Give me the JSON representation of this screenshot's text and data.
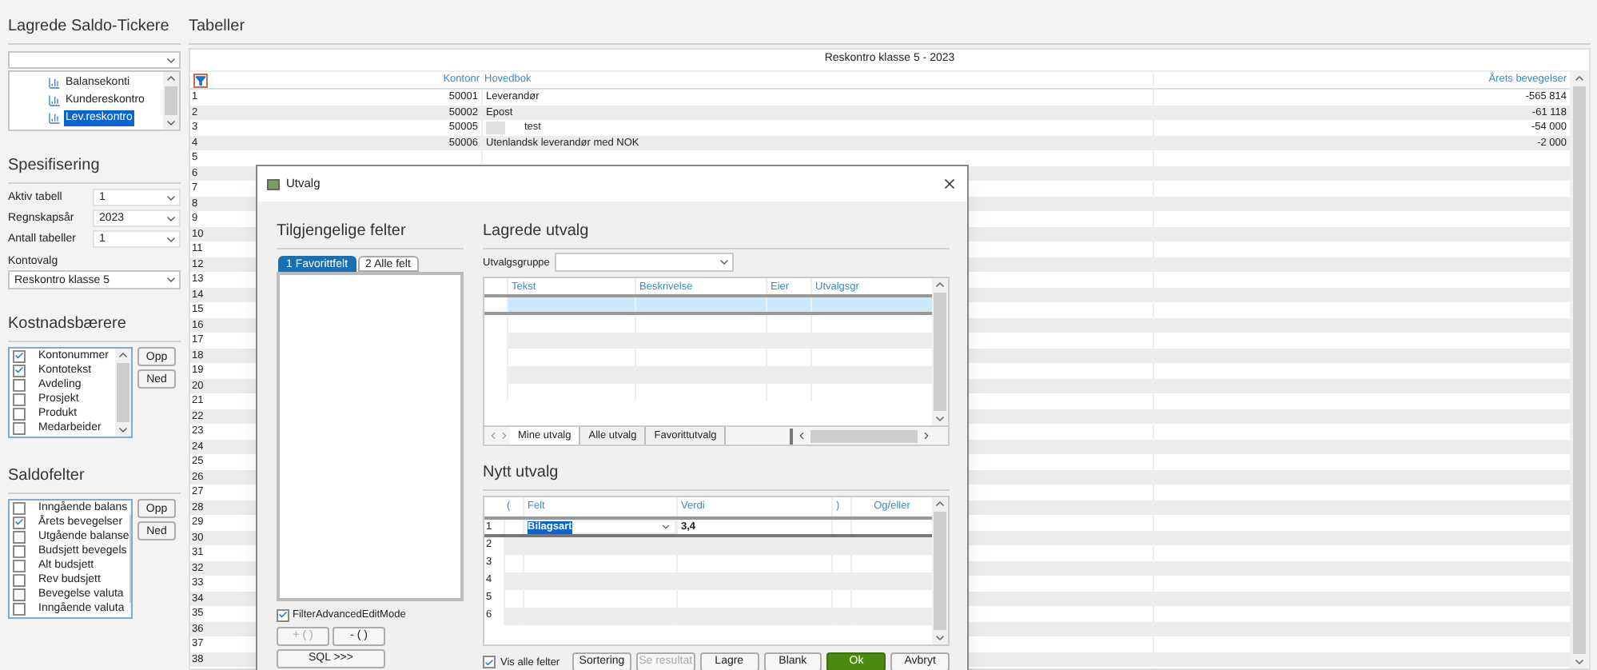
{
  "left_panel": {
    "saldo_tickers": {
      "title": "Lagrede Saldo-Tickere",
      "items": [
        {
          "label": "Balansekonti",
          "selected": false
        },
        {
          "label": "Kundereskontro",
          "selected": false
        },
        {
          "label": "Lev.reskontro",
          "selected": true
        }
      ]
    },
    "spesifisering": {
      "title": "Spesifisering",
      "fields": [
        {
          "label": "Aktiv tabell",
          "value": "1"
        },
        {
          "label": "Regnskapsår",
          "value": "2023"
        },
        {
          "label": "Antall tabeller",
          "value": "1"
        }
      ],
      "kontovalg": {
        "label": "Kontovalg",
        "value": "Reskontro klasse 5"
      }
    },
    "kostnadsbaerere": {
      "title": "Kostnadsbærere",
      "items": [
        {
          "label": "Kontonummer",
          "checked": true
        },
        {
          "label": "Kontotekst",
          "checked": true
        },
        {
          "label": "Avdeling",
          "checked": false
        },
        {
          "label": "Prosjekt",
          "checked": false
        },
        {
          "label": "Produkt",
          "checked": false
        },
        {
          "label": "Medarbeider",
          "checked": false
        }
      ],
      "buttons": [
        "Opp",
        "Ned"
      ]
    },
    "saldofelter": {
      "title": "Saldofelter",
      "items": [
        {
          "label": "Inngående balans",
          "checked": false
        },
        {
          "label": "Årets bevegelser",
          "checked": true
        },
        {
          "label": "Utgående balanse",
          "checked": false
        },
        {
          "label": "Budsjett bevegels",
          "checked": false
        },
        {
          "label": "Alt budsjett",
          "checked": false
        },
        {
          "label": "Rev budsjett",
          "checked": false
        },
        {
          "label": "Bevegelse valuta",
          "checked": false
        },
        {
          "label": "Inngående valuta",
          "checked": false
        }
      ],
      "buttons": [
        "Opp",
        "Ned"
      ]
    }
  },
  "tables": {
    "title": "Tabeller",
    "table_title": "Reskontro klasse 5 - 2023",
    "columns": [
      "Kontonr",
      "Hovedbok",
      "Årets bevegelser"
    ],
    "rows": [
      {
        "number": "1",
        "kontonr": "50001",
        "hovedbok": "Leverandør",
        "amount": "-565 814",
        "redacted": false
      },
      {
        "number": "2",
        "kontonr": "50002",
        "hovedbok": "Epost",
        "amount": "-61 118",
        "redacted": false
      },
      {
        "number": "3",
        "kontonr": "50005",
        "hovedbok": "test",
        "amount": "-54 000",
        "redacted": true
      },
      {
        "number": "4",
        "kontonr": "50006",
        "hovedbok": "Utenlandsk leverandør med NOK",
        "amount": "-2 000",
        "redacted": false
      }
    ],
    "empty_rows": [
      "5",
      "6",
      "7",
      "8",
      "9",
      "10",
      "11",
      "12",
      "13",
      "14",
      "15",
      "16",
      "17",
      "18",
      "19",
      "20",
      "21",
      "22",
      "23",
      "24",
      "25",
      "26",
      "27",
      "28",
      "29",
      "30",
      "31",
      "32",
      "33",
      "34",
      "35",
      "36",
      "37",
      "38"
    ]
  },
  "dialog": {
    "title": "Utvalg",
    "available_fields": {
      "title": "Tilgjengelige felter",
      "tabs": [
        {
          "label": "1 Favorittfelt",
          "selected": true
        },
        {
          "label": "2 Alle felt",
          "selected": false
        }
      ],
      "advanced_mode": {
        "label": "FilterAdvancedEditMode",
        "checked": true
      },
      "buttons": [
        {
          "label": "+ ( )",
          "disabled": true
        },
        {
          "label": "- ( )",
          "disabled": false
        }
      ],
      "sql_button": "SQL >>>"
    },
    "saved": {
      "title": "Lagrede utvalg",
      "group_label": "Utvalgsgruppe",
      "columns": [
        "Tekst",
        "Beskrivelse",
        "Eier",
        "Utvalgsgr"
      ],
      "rows": [
        {
          "selected": true
        },
        {
          "selected": false
        },
        {
          "selected": false
        },
        {
          "selected": false
        },
        {
          "selected": false
        },
        {
          "selected": false
        }
      ],
      "tabs": [
        {
          "label": "Mine utvalg",
          "selected": true
        },
        {
          "label": "Alle utvalg",
          "selected": false
        },
        {
          "label": "Favorittutvalg",
          "selected": false
        }
      ]
    },
    "new_selection": {
      "title": "Nytt utvalg",
      "columns": [
        "(",
        "Felt",
        "Verdi",
        ")",
        "Og/eller"
      ],
      "rows": [
        {
          "number": "1",
          "felt": "Bilagsart",
          "verdi": "3,4",
          "editing": true
        },
        {
          "number": "2",
          "editing": false
        },
        {
          "number": "3",
          "editing": false
        },
        {
          "number": "4",
          "editing": false
        },
        {
          "number": "5",
          "editing": false
        },
        {
          "number": "6",
          "editing": false
        }
      ]
    },
    "show_all": {
      "label": "Vis alle felter",
      "checked": true
    },
    "buttons": [
      {
        "label": "Sortering",
        "kind": "normal",
        "disabled": false
      },
      {
        "label": "Se resultat",
        "kind": "normal",
        "disabled": true
      },
      {
        "label": "Lagre",
        "kind": "normal",
        "disabled": false
      },
      {
        "label": "Blank",
        "kind": "normal",
        "disabled": false
      },
      {
        "label": "Ok",
        "kind": "primary",
        "disabled": false
      },
      {
        "label": "Avbryt",
        "kind": "normal",
        "disabled": false
      }
    ]
  }
}
